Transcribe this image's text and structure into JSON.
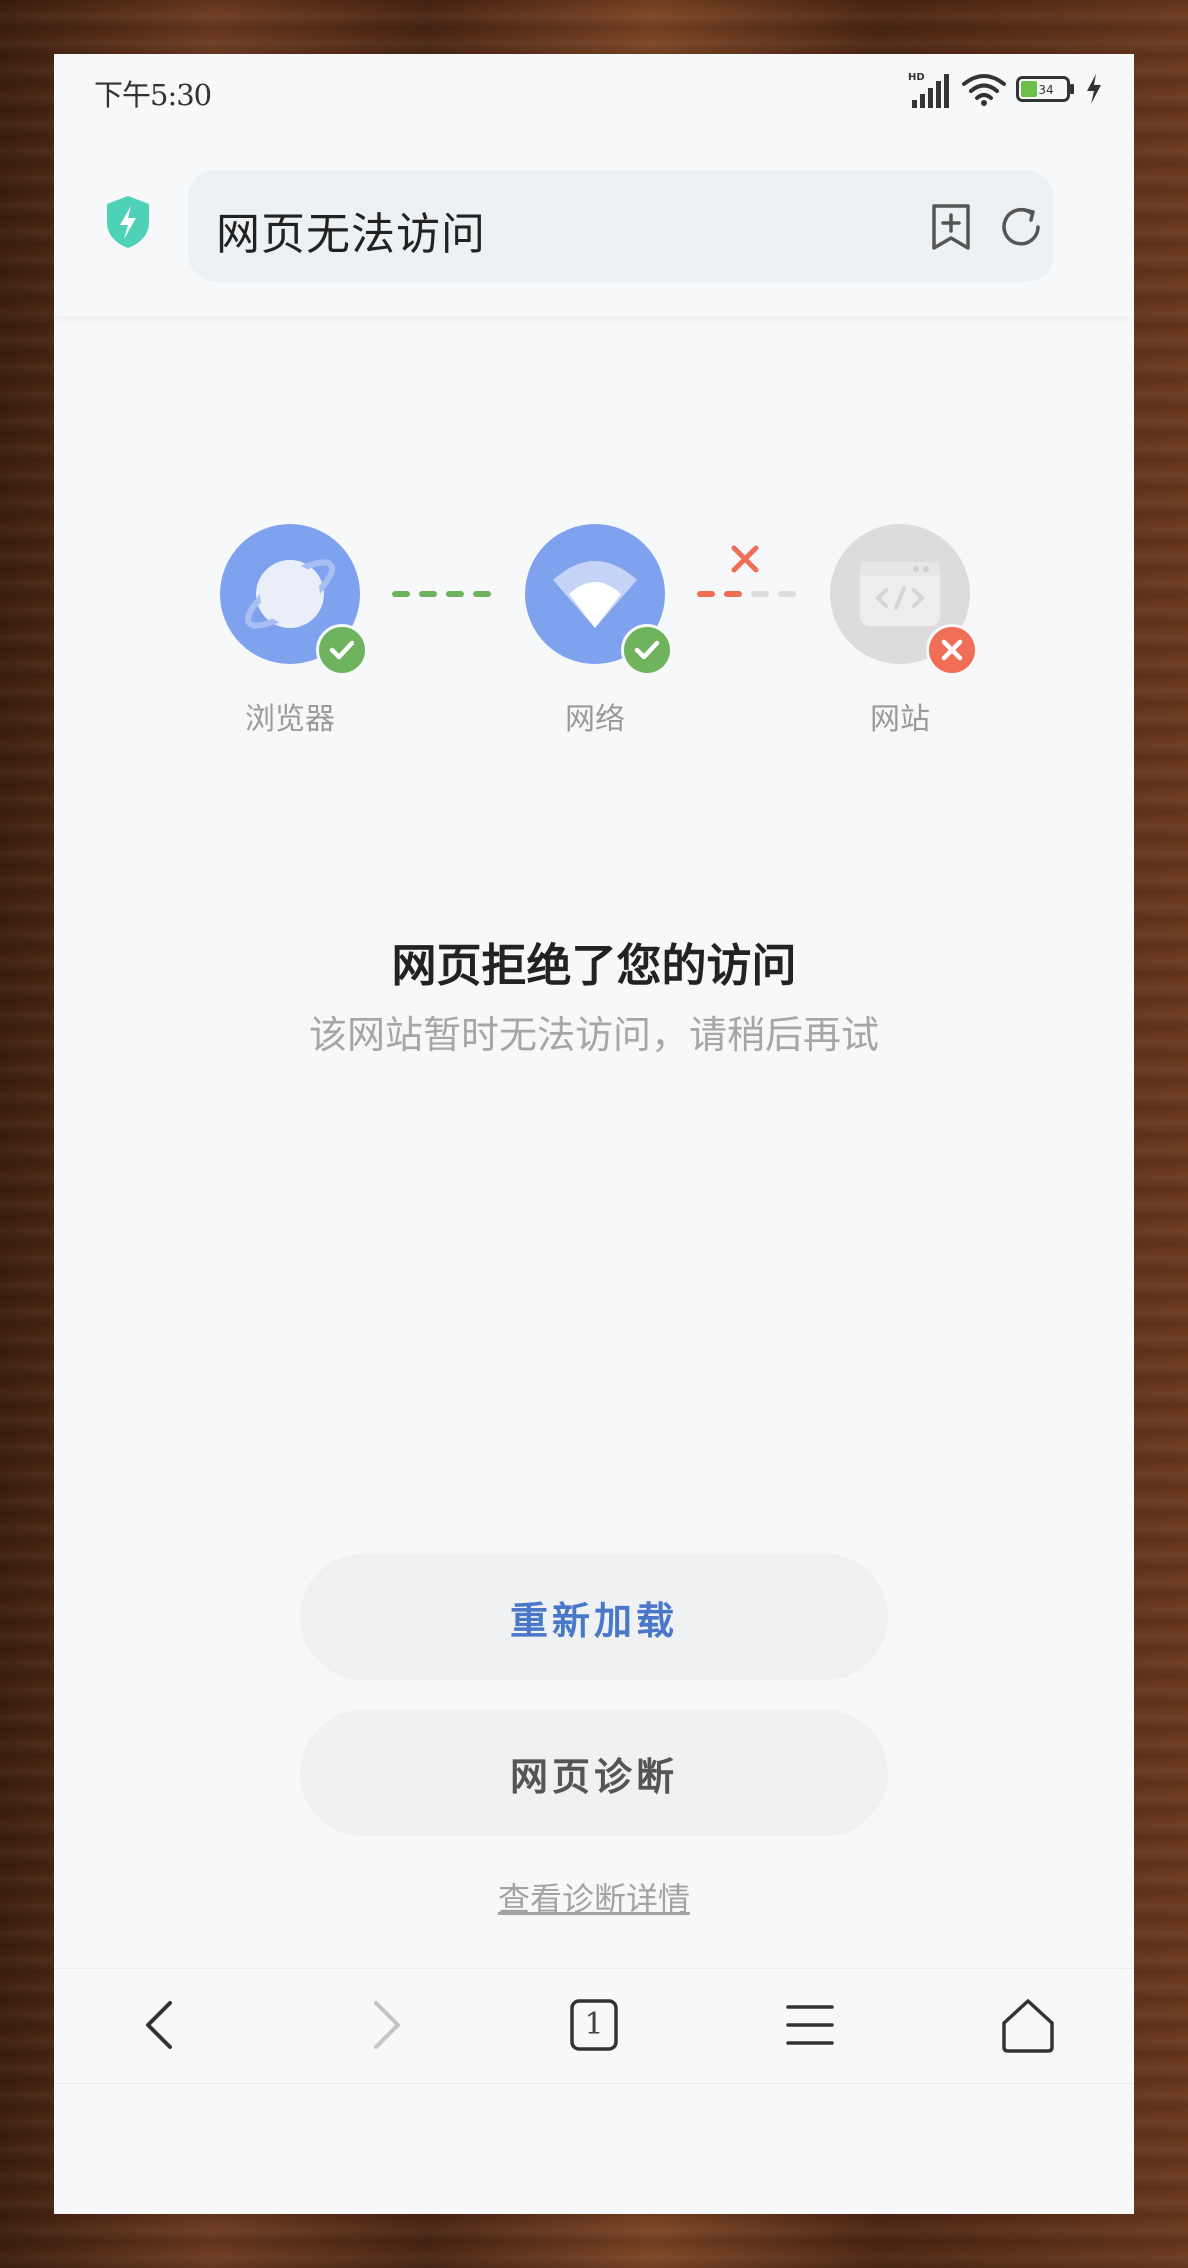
{
  "status_bar": {
    "time": "下午5:30",
    "hd_label": "HD",
    "battery_level": "34",
    "icons": [
      "signal-icon",
      "wifi-icon",
      "battery-icon",
      "charging-icon"
    ]
  },
  "address_bar": {
    "security_icon": "shield-bolt-icon",
    "title": "网页无法访问",
    "actions": [
      "add-bookmark-icon",
      "reload-icon"
    ]
  },
  "diagnosis": {
    "nodes": [
      {
        "label": "浏览器",
        "icon": "planet-icon",
        "status": "ok"
      },
      {
        "label": "网络",
        "icon": "wifi-icon",
        "status": "ok"
      },
      {
        "label": "网站",
        "icon": "code-window-icon",
        "status": "error"
      }
    ],
    "links": [
      {
        "status": "ok"
      },
      {
        "status": "error"
      }
    ]
  },
  "message": {
    "title": "网页拒绝了您的访问",
    "subtitle": "该网站暂时无法访问，请稍后再试"
  },
  "buttons": {
    "reload_label": "重新加载",
    "diagnose_label": "网页诊断",
    "details_link": "查看诊断详情"
  },
  "bottom_nav": {
    "tabs_count": "1",
    "items": [
      "back-icon",
      "forward-icon",
      "tabs-icon",
      "menu-icon",
      "home-icon"
    ]
  },
  "colors": {
    "accent_blue": "#7fa2ee",
    "ok_green": "#70b35f",
    "error_red": "#ef6e55",
    "shield_teal": "#4fd1b8",
    "button_text_blue": "#4a78c8"
  }
}
